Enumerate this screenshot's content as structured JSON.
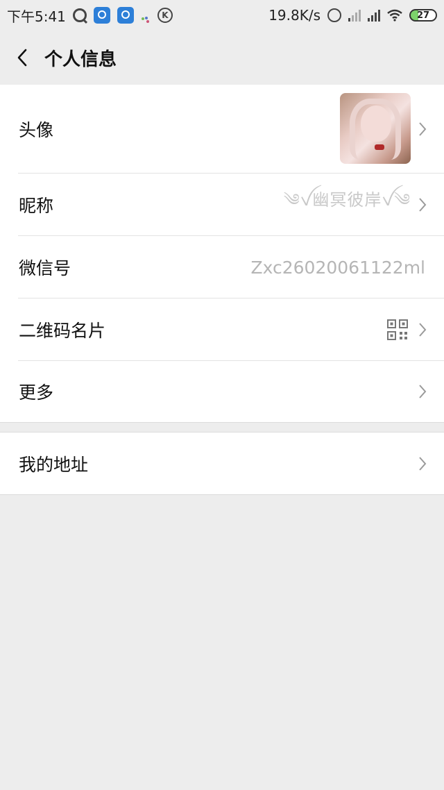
{
  "status_bar": {
    "time": "下午5:41",
    "net_speed": "19.8K/s",
    "battery": "27"
  },
  "nav": {
    "back_icon": "chevron-left-icon",
    "title": "个人信息"
  },
  "profile": {
    "avatar_label": "头像",
    "nickname_label": "昵称",
    "nickname_value": "༄ꪜ幽冥彼岸ꪜ༄",
    "wechat_id_label": "微信号",
    "wechat_id_value": "Zxc26020061122ml",
    "qr_label": "二维码名片",
    "more_label": "更多"
  },
  "address": {
    "label": "我的地址"
  },
  "colors": {
    "background": "#ededed",
    "row_bg": "#ffffff",
    "secondary_text": "#b5b5b5"
  }
}
